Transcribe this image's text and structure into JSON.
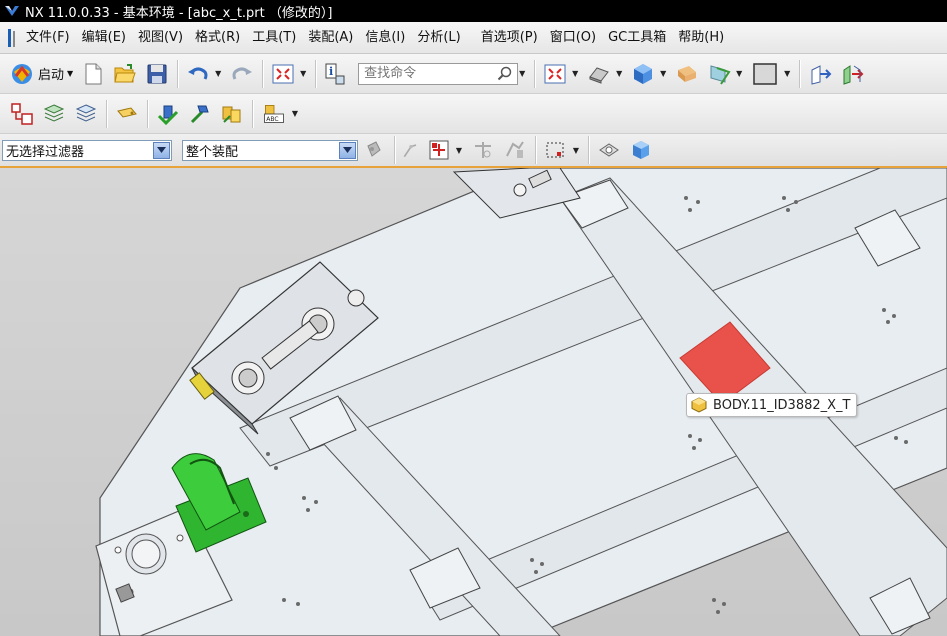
{
  "window": {
    "title": "NX 11.0.0.33 - 基本环境 - [abc_x_t.prt （修改的）]"
  },
  "menu": {
    "items": [
      {
        "label": "文件(F)",
        "name": "menu-file"
      },
      {
        "label": "编辑(E)",
        "name": "menu-edit"
      },
      {
        "label": "视图(V)",
        "name": "menu-view"
      },
      {
        "label": "格式(R)",
        "name": "menu-format"
      },
      {
        "label": "工具(T)",
        "name": "menu-tools"
      },
      {
        "label": "装配(A)",
        "name": "menu-assembly"
      },
      {
        "label": "信息(I)",
        "name": "menu-information"
      },
      {
        "label": "分析(L)",
        "name": "menu-analysis"
      },
      {
        "label": "首选项(P)",
        "name": "menu-preferences"
      },
      {
        "label": "窗口(O)",
        "name": "menu-window"
      },
      {
        "label": "GC工具箱",
        "name": "menu-gc-toolkit"
      },
      {
        "label": "帮助(H)",
        "name": "menu-help"
      }
    ]
  },
  "toolbar": {
    "start_label": "启动",
    "search_placeholder": "查找命令"
  },
  "filters": {
    "selection_filter": "无选择过滤器",
    "scope": "整个装配"
  },
  "viewport": {
    "tooltip_label": "BODY.11_ID3882_X_T",
    "highlight_color": "#e8524a",
    "selected_part_color": "#2fb52f",
    "model_color": "#e6ebf0"
  }
}
